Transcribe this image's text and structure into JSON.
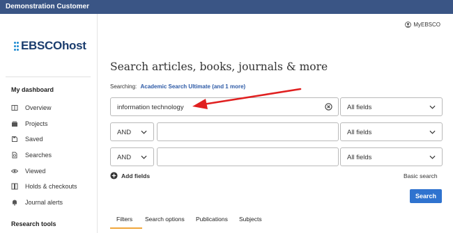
{
  "topbar": {
    "title": "Demonstration Customer"
  },
  "sidebar": {
    "logo": "EBSCOhost",
    "dashboard_heading": "My dashboard",
    "items": [
      {
        "label": "Overview",
        "icon": "overview-icon"
      },
      {
        "label": "Projects",
        "icon": "projects-icon"
      },
      {
        "label": "Saved",
        "icon": "saved-icon"
      },
      {
        "label": "Searches",
        "icon": "searches-icon"
      },
      {
        "label": "Viewed",
        "icon": "eye-icon"
      },
      {
        "label": "Holds & checkouts",
        "icon": "holds-icon"
      },
      {
        "label": "Journal alerts",
        "icon": "bell-icon"
      }
    ],
    "research_heading": "Research tools"
  },
  "header": {
    "myebsco": "MyEBSCO"
  },
  "search": {
    "heading": "Search articles, books, journals & more",
    "searching_label": "Searching:",
    "searching_db": "Academic Search Ultimate (and 1 more)",
    "rows": [
      {
        "query": "information technology",
        "field": "All fields"
      },
      {
        "bool": "AND",
        "query": "",
        "field": "All fields"
      },
      {
        "bool": "AND",
        "query": "",
        "field": "All fields"
      }
    ],
    "add_fields": "Add fields",
    "basic_search": "Basic search",
    "search_button": "Search"
  },
  "tabs": [
    "Filters",
    "Search options",
    "Publications",
    "Subjects"
  ],
  "colors": {
    "topbar": "#3a5585",
    "accent": "#2f73cf",
    "arrow": "#e02020",
    "tab_underline": "#f0a63a"
  }
}
